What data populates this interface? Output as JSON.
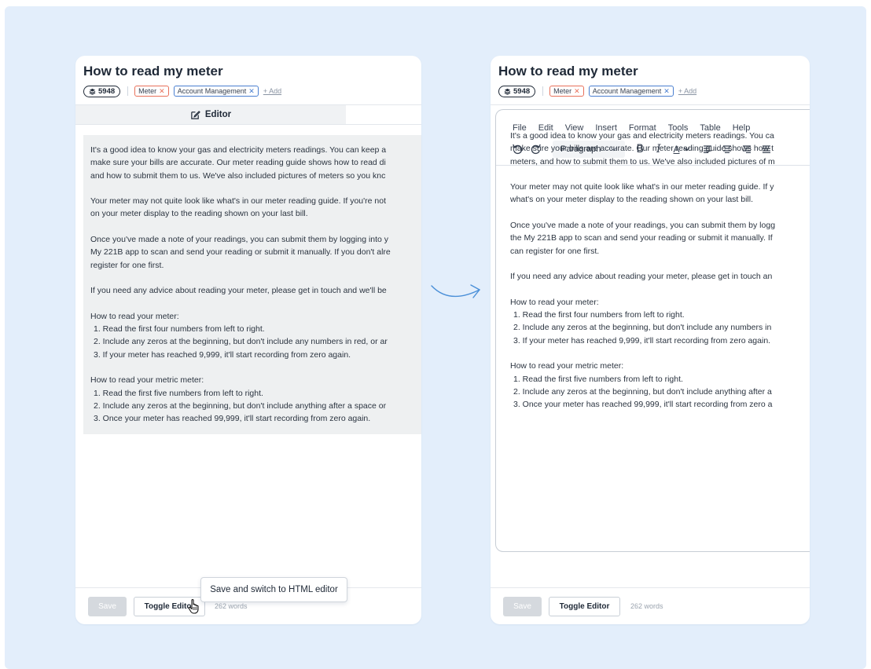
{
  "article": {
    "title": "How to read my meter",
    "id": "5948",
    "tags": [
      {
        "label": "Meter"
      },
      {
        "label": "Account Management"
      }
    ],
    "add_label": "+ Add"
  },
  "left_panel": {
    "editor_tab": "Editor",
    "paragraphs": [
      "It's a good idea to know your gas and electricity meters readings. You can keep a",
      "make sure your bills are accurate. Our meter reading guide shows how to read di",
      "and how to submit them to us. We've also included pictures of meters so you knc",
      "Your meter may not quite look like what's in our meter reading guide. If you're not",
      "on your meter display to the reading shown on your last bill.",
      "Once you've made a note of your readings, you can submit them by logging into y",
      "My 221B app to scan and send your reading or submit it manually. If you don't alre",
      "register for one first.",
      "If you need any advice about reading your meter, please get in touch and we'll be"
    ],
    "meter_heading": "How to read your meter:",
    "meter_steps": [
      "1. Read the first four numbers from left to right.",
      "2. Include any zeros at the beginning, but don't include any numbers in red, or ar",
      "3. If your meter has reached 9,999, it'll start recording from zero again."
    ],
    "metric_heading": "How to read your metric meter:",
    "metric_steps": [
      "1. Read the first five numbers from left to right.",
      "2. Include any zeros at the beginning, but don't include anything after a space or",
      "3. Once your meter has reached 99,999, it'll start recording from zero again."
    ],
    "save_label": "Save",
    "toggle_label": "Toggle Editor",
    "word_count": "262 words",
    "tooltip": "Save and switch to HTML editor"
  },
  "right_panel": {
    "menu": [
      "File",
      "Edit",
      "View",
      "Insert",
      "Format",
      "Tools",
      "Table",
      "Help"
    ],
    "block_format": "Paragraph",
    "format_bold": "B",
    "format_italic": "I",
    "format_color": "A",
    "paragraphs": [
      "It's a good idea to know your gas and electricity meters readings. You ca",
      "make sure your bills are accurate. Our meter reading guide shows how t",
      "meters, and how to submit them to us. We've also included pictures of m",
      "Your meter may not quite look like what's in our meter reading guide. If y",
      "what's on your meter display to the reading shown on your last bill.",
      "Once you've made a note of your readings, you can submit them by logg",
      "the My 221B app to scan and send your reading or submit it manually. If",
      "can register for one first.",
      "If you need any advice about reading your meter, please get in touch an"
    ],
    "meter_heading": "How to read your meter:",
    "meter_steps": [
      "1. Read the first four numbers from left to right.",
      "2. Include any zeros at the beginning, but don't include any numbers in",
      "3. If your meter has reached 9,999, it'll start recording from zero again."
    ],
    "metric_heading": "How to read your metric meter:",
    "metric_steps": [
      "1. Read the first five numbers from left to right.",
      "2. Include any zeros at the beginning, but don't include anything after a",
      "3. Once your meter has reached 99,999, it'll start recording from zero a"
    ],
    "save_label": "Save",
    "toggle_label": "Toggle Editor",
    "word_count": "262 words"
  },
  "colors": {
    "backdrop": "#e3eefb",
    "tag_meter": "#e8705a",
    "tag_account": "#4a7fd0",
    "arrow": "#4a8fd8"
  }
}
